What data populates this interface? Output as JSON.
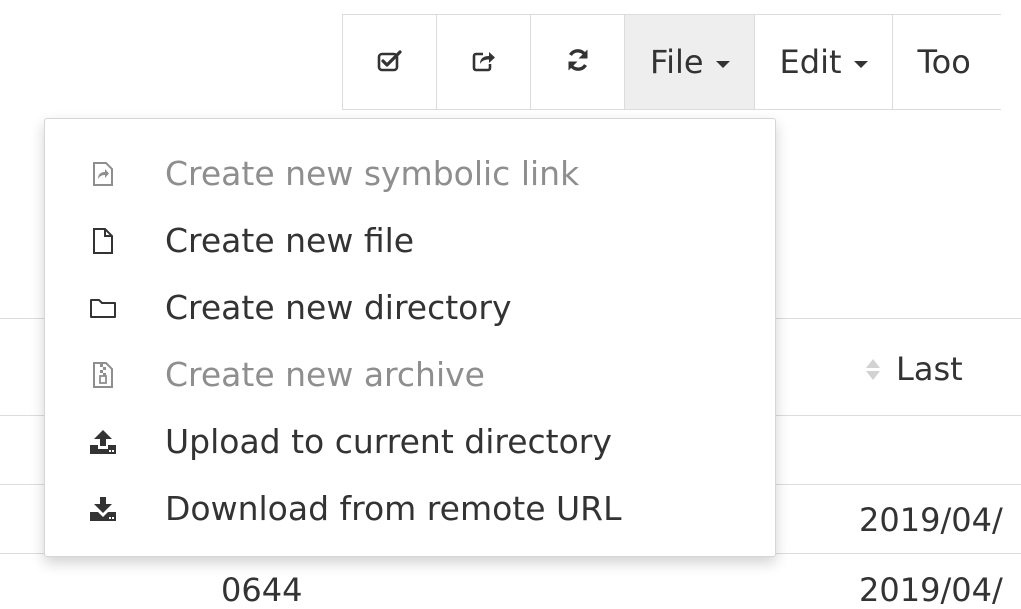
{
  "toolbar": {
    "icon_buttons": [
      {
        "icon": "check-square-icon"
      },
      {
        "icon": "share-icon"
      },
      {
        "icon": "refresh-icon"
      }
    ],
    "menus": [
      {
        "label": "File",
        "active": true
      },
      {
        "label": "Edit",
        "active": false
      },
      {
        "label": "Too",
        "active": false
      }
    ]
  },
  "file_menu": {
    "items": [
      {
        "label": "Create new symbolic link",
        "icon": "symlink-icon",
        "enabled": false
      },
      {
        "label": "Create new file",
        "icon": "file-icon",
        "enabled": true
      },
      {
        "label": "Create new directory",
        "icon": "folder-icon",
        "enabled": true
      },
      {
        "label": "Create new archive",
        "icon": "archive-icon",
        "enabled": false
      },
      {
        "label": "Upload to current directory",
        "icon": "upload-icon",
        "enabled": true
      },
      {
        "label": "Download from remote URL",
        "icon": "download-icon",
        "enabled": true
      }
    ]
  },
  "table": {
    "sort_column_label": "Last",
    "rows": [
      {
        "permissions": "",
        "date": "2019/04/"
      },
      {
        "permissions": "0644",
        "date": "2019/04/"
      }
    ]
  }
}
